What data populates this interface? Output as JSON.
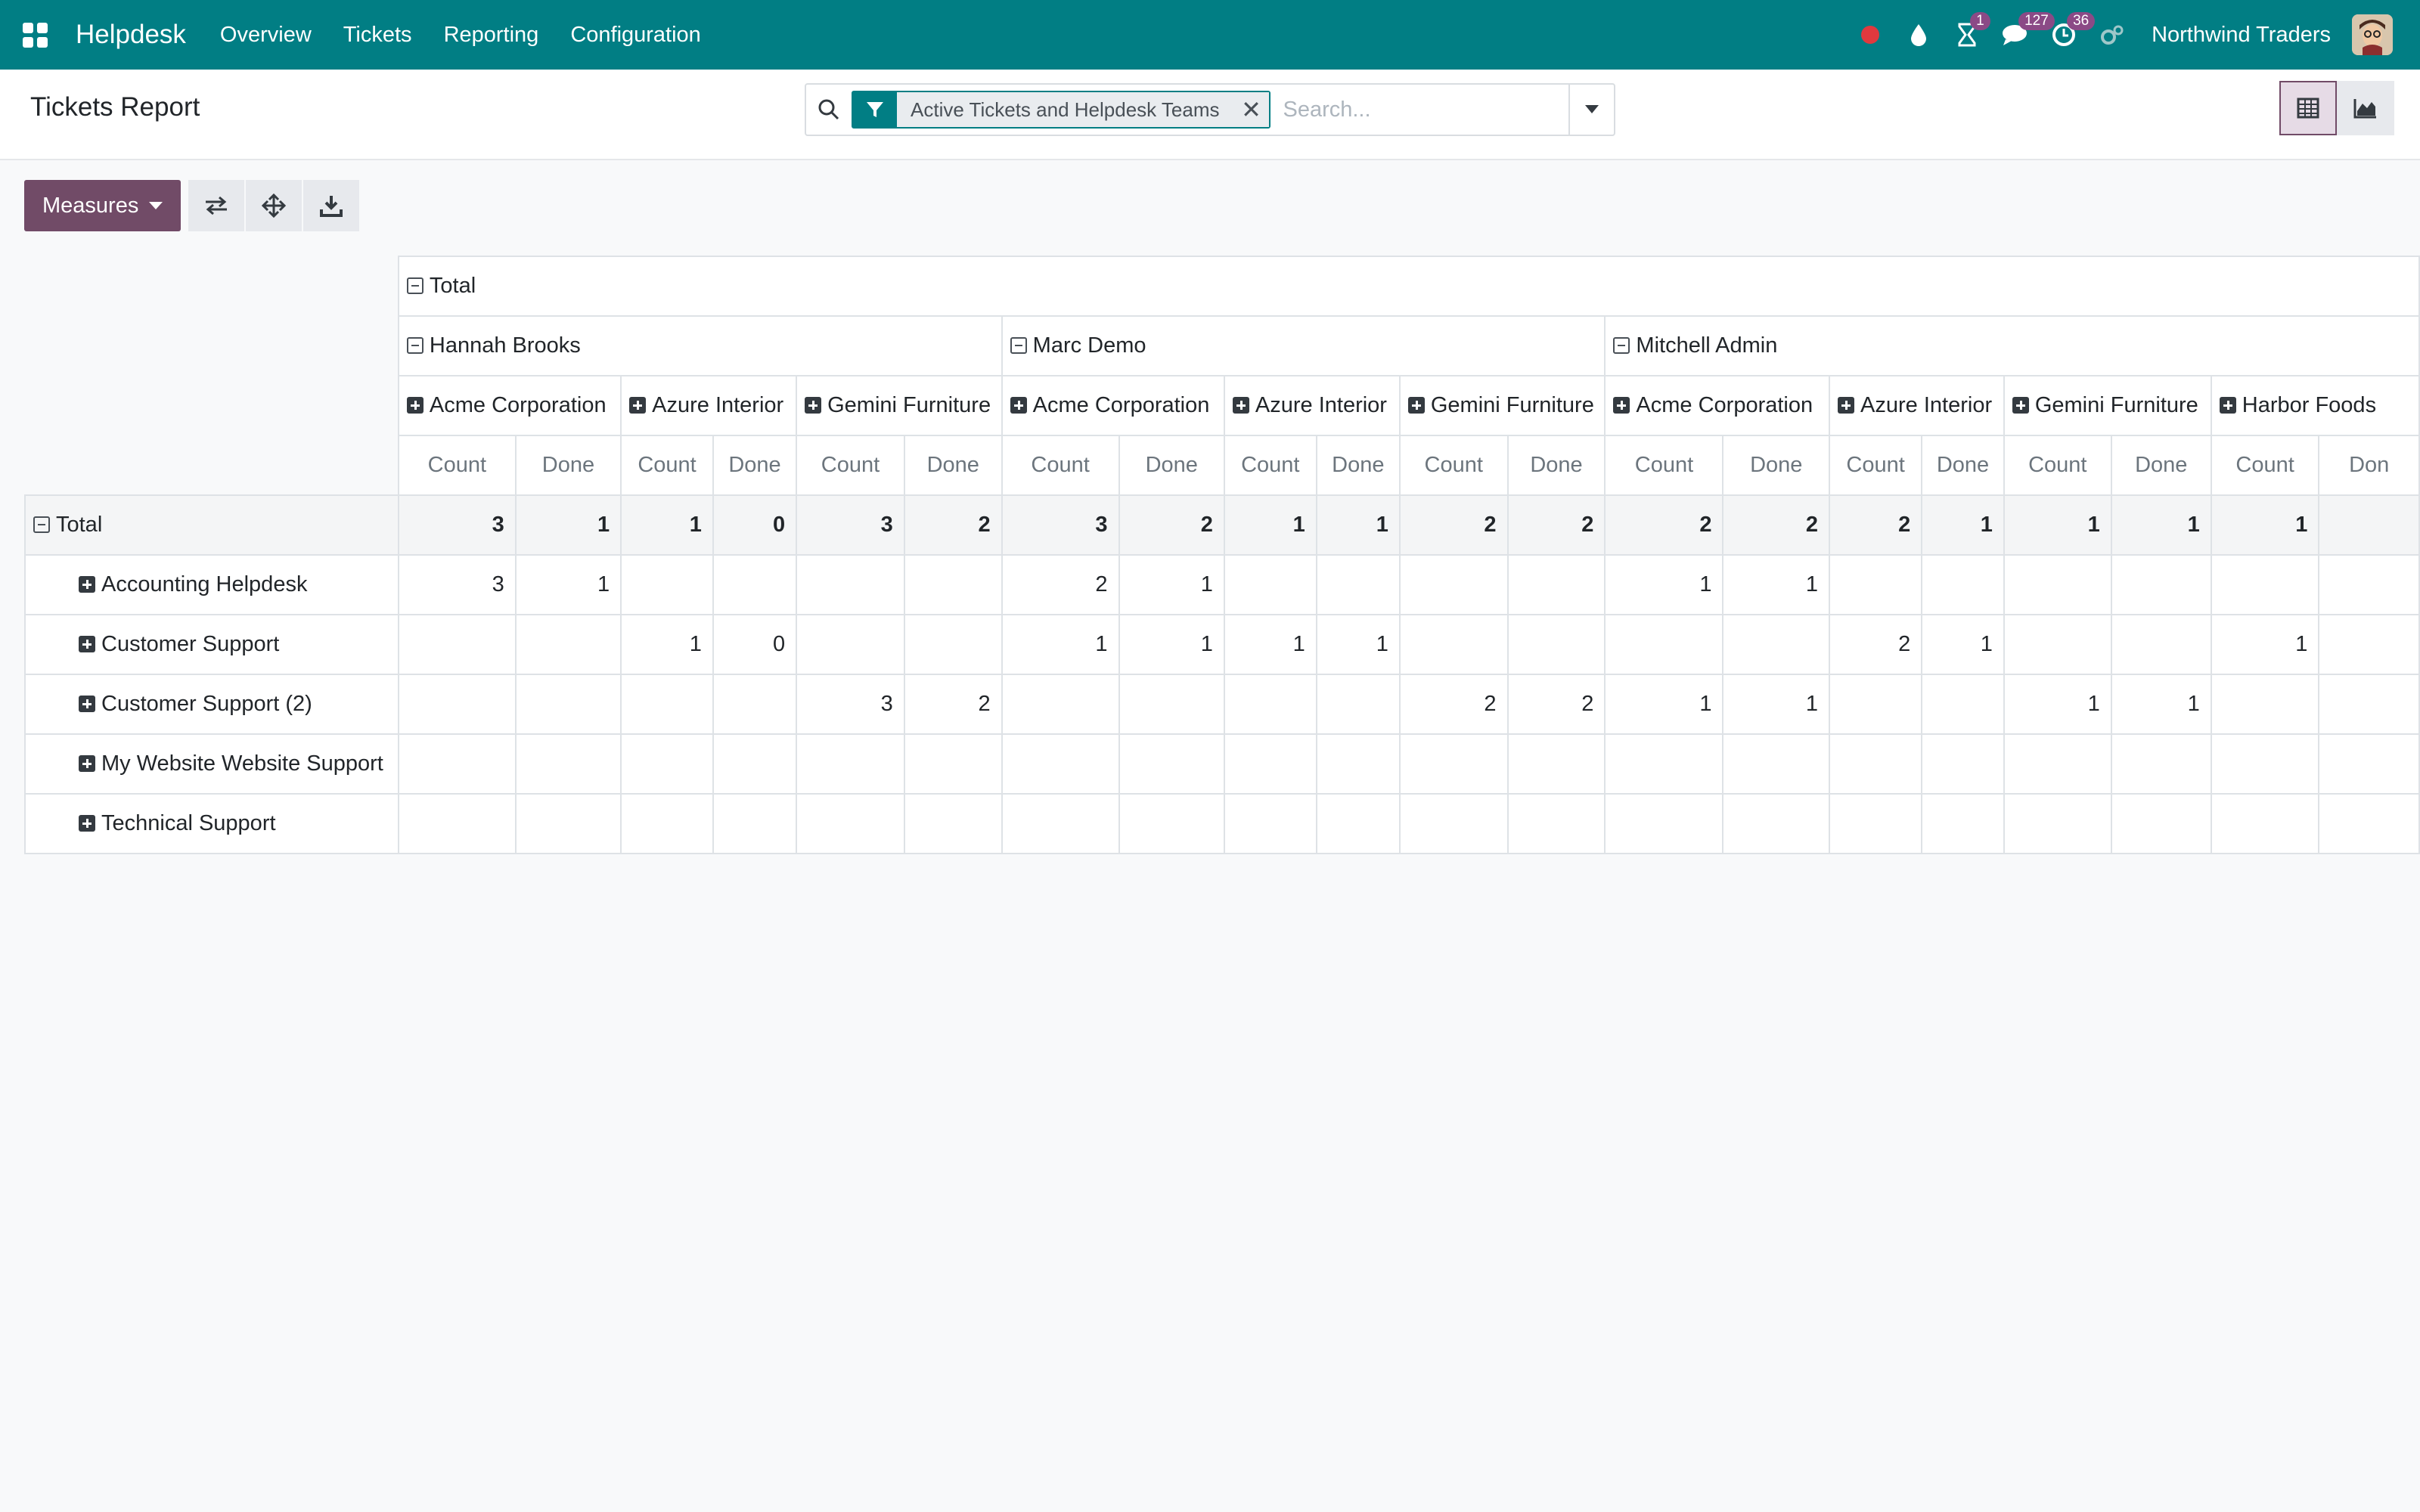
{
  "navbar": {
    "app_name": "Helpdesk",
    "menu": [
      "Overview",
      "Tickets",
      "Reporting",
      "Configuration"
    ],
    "activity_badge": "1",
    "messages_badge": "127",
    "updates_badge": "36",
    "company": "Northwind Traders"
  },
  "control_panel": {
    "title": "Tickets Report",
    "facet_label": "Active Tickets and Helpdesk Teams",
    "search_placeholder": "Search..."
  },
  "toolbar": {
    "measures_label": "Measures"
  },
  "pivot": {
    "total_label": "Total",
    "users": [
      {
        "name": "Hannah Brooks",
        "customers": [
          "Acme Corporation",
          "Azure Interior",
          "Gemini Furniture"
        ]
      },
      {
        "name": "Marc Demo",
        "customers": [
          "Acme Corporation",
          "Azure Interior",
          "Gemini Furniture"
        ]
      },
      {
        "name": "Mitchell Admin",
        "customers": [
          "Acme Corporation",
          "Azure Interior",
          "Gemini Furniture",
          "Harbor Foods"
        ]
      }
    ],
    "measures": [
      "Count",
      "Done"
    ],
    "cutoff_measure": "Don",
    "total_row": [
      "3",
      "1",
      "1",
      "0",
      "3",
      "2",
      "3",
      "2",
      "1",
      "1",
      "2",
      "2",
      "2",
      "2",
      "2",
      "1",
      "1",
      "1",
      "1"
    ],
    "rows": [
      {
        "label": "Accounting Helpdesk",
        "values": [
          "3",
          "1",
          "",
          "",
          "",
          "",
          "2",
          "1",
          "",
          "",
          "",
          "",
          "1",
          "1",
          "",
          "",
          "",
          "",
          ""
        ]
      },
      {
        "label": "Customer Support",
        "values": [
          "",
          "",
          "1",
          "0",
          "",
          "",
          "1",
          "1",
          "1",
          "1",
          "",
          "",
          "",
          "",
          "2",
          "1",
          "",
          "",
          "1"
        ]
      },
      {
        "label": "Customer Support (2)",
        "values": [
          "",
          "",
          "",
          "",
          "3",
          "2",
          "",
          "",
          "",
          "",
          "2",
          "2",
          "1",
          "1",
          "",
          "",
          "1",
          "1",
          ""
        ]
      },
      {
        "label": "My Website Website Support",
        "values": [
          "",
          "",
          "",
          "",
          "",
          "",
          "",
          "",
          "",
          "",
          "",
          "",
          "",
          "",
          "",
          "",
          "",
          "",
          ""
        ]
      },
      {
        "label": "Technical Support",
        "values": [
          "",
          "",
          "",
          "",
          "",
          "",
          "",
          "",
          "",
          "",
          "",
          "",
          "",
          "",
          "",
          "",
          "",
          "",
          ""
        ]
      }
    ]
  }
}
